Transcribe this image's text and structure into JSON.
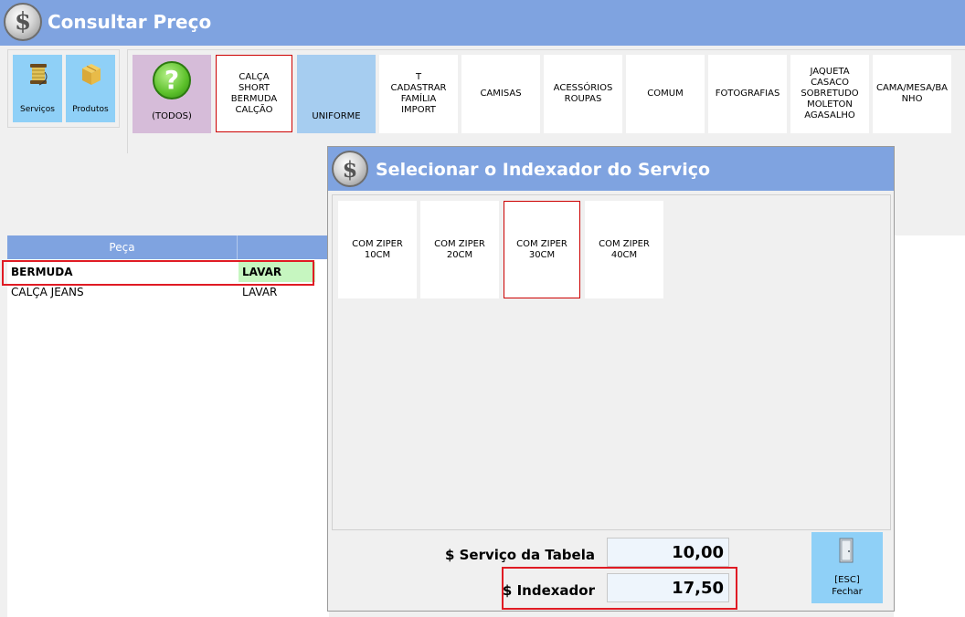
{
  "window": {
    "title": "Consultar Preço"
  },
  "left_tools": [
    {
      "label": "Serviços",
      "icon": "thread-spool-icon"
    },
    {
      "label": "Produtos",
      "icon": "box-icon"
    }
  ],
  "categories": [
    {
      "label": "(TODOS)",
      "icon": "question-icon"
    },
    {
      "label": "CALÇA SHORT BERMUDA CALÇÃO"
    },
    {
      "label": "UNIFORME"
    },
    {
      "label": "T CADASTRAR FAMÍLIA IMPORT"
    },
    {
      "label": "CAMISAS"
    },
    {
      "label": "ACESSÓRIOS ROUPAS"
    },
    {
      "label": "COMUM"
    },
    {
      "label": "FOTOGRAFIAS"
    },
    {
      "label": "JAQUETA CASACO SOBRETUDO MOLETON AGASALHO"
    },
    {
      "label": "CAMA/MESA/BANHO"
    }
  ],
  "grid": {
    "columns": [
      "Peça",
      ""
    ],
    "rows": [
      {
        "peca": "BERMUDA",
        "servico": "LAVAR",
        "selected": true
      },
      {
        "peca": "CALÇA JEANS",
        "servico": "LAVAR",
        "selected": false
      }
    ]
  },
  "dialog": {
    "title": "Selecionar o Indexador do Serviço",
    "options": [
      {
        "label": "COM ZIPER 10CM"
      },
      {
        "label": "COM ZIPER 20CM"
      },
      {
        "label": "COM ZIPER 30CM",
        "selected": true
      },
      {
        "label": "COM ZIPER 40CM"
      }
    ],
    "servico_tabela_label": "$ Serviço da Tabela",
    "servico_tabela_value": "10,00",
    "indexador_label": "$ Indexador",
    "indexador_value": "17,50",
    "esc_key": "[ESC]",
    "esc_label": "Fechar"
  },
  "colors": {
    "header_blue": "#7fa3e0",
    "button_blue": "#8fd0f7",
    "selected_green": "#c6f6c0",
    "highlight_red": "#e01b24"
  }
}
